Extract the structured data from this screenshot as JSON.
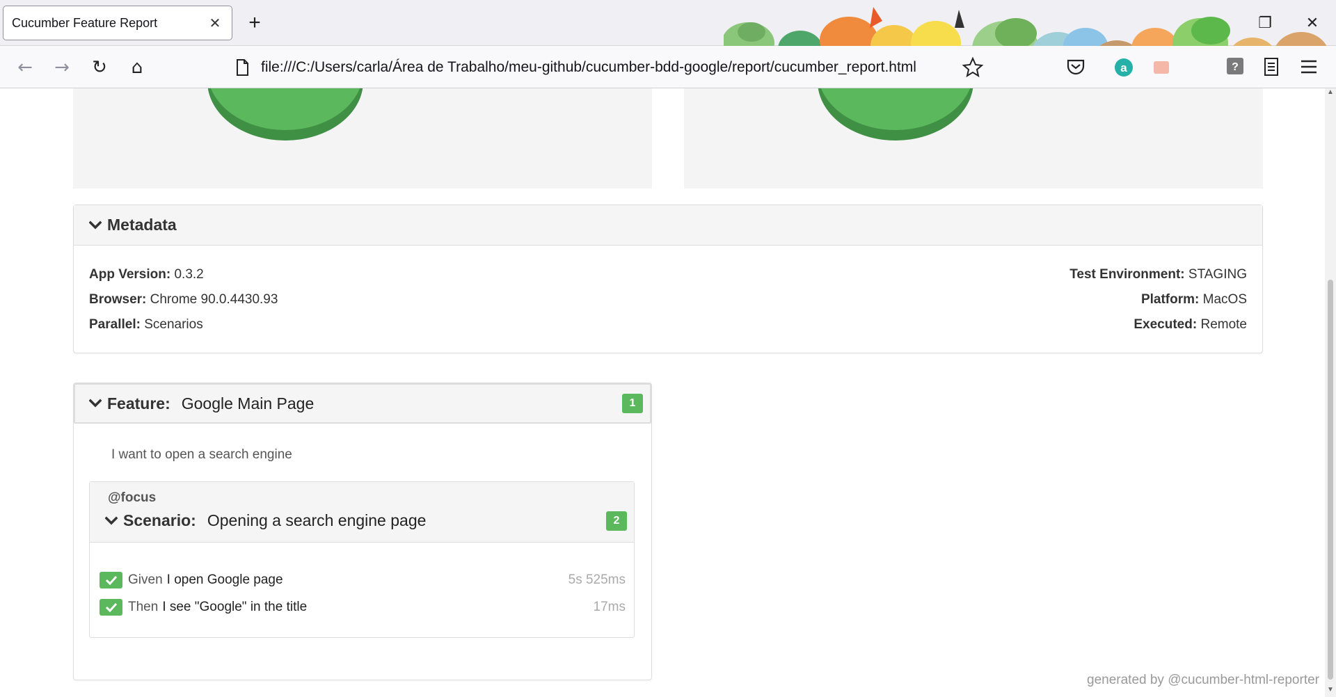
{
  "browser": {
    "tab_title": "Cucumber Feature Report",
    "tab_close": "✕",
    "new_tab": "+",
    "url": "file:///C:/Users/carla/Área de Trabalho/meu-github/cucumber-bdd-google/report/cucumber_report.html",
    "nav": {
      "back": "←",
      "forward": "→",
      "reload": "↻",
      "home": "⌂"
    },
    "window": {
      "minimize": "–",
      "restore": "❐",
      "close": "✕"
    },
    "toolbar_icons": [
      "star-icon",
      "pocket-icon",
      "amazon-extension-icon",
      "extension-icon",
      "help-extension-icon",
      "reader-icon",
      "menu-icon"
    ],
    "accent_color": "#5cb85c"
  },
  "metadata": {
    "title": "Metadata",
    "left": [
      {
        "label": "App Version:",
        "value": "0.3.2"
      },
      {
        "label": "Browser:",
        "value": "Chrome 90.0.4430.93"
      },
      {
        "label": "Parallel:",
        "value": "Scenarios"
      }
    ],
    "right": [
      {
        "label": "Test Environment:",
        "value": "STAGING"
      },
      {
        "label": "Platform:",
        "value": "MacOS"
      },
      {
        "label": "Executed:",
        "value": "Remote"
      }
    ]
  },
  "feature": {
    "keyword": "Feature:",
    "name": "Google Main Page",
    "badge": "1",
    "description": "I want to open a search engine",
    "scenario": {
      "tag": "@focus",
      "keyword": "Scenario:",
      "name": "Opening a search engine page",
      "badge": "2",
      "steps": [
        {
          "keyword": "Given",
          "text": "I open Google page",
          "duration": "5s 525ms"
        },
        {
          "keyword": "Then",
          "text": "I see \"Google\" in the title",
          "duration": "17ms"
        }
      ]
    }
  },
  "footer": "generated by @cucumber-html-reporter"
}
